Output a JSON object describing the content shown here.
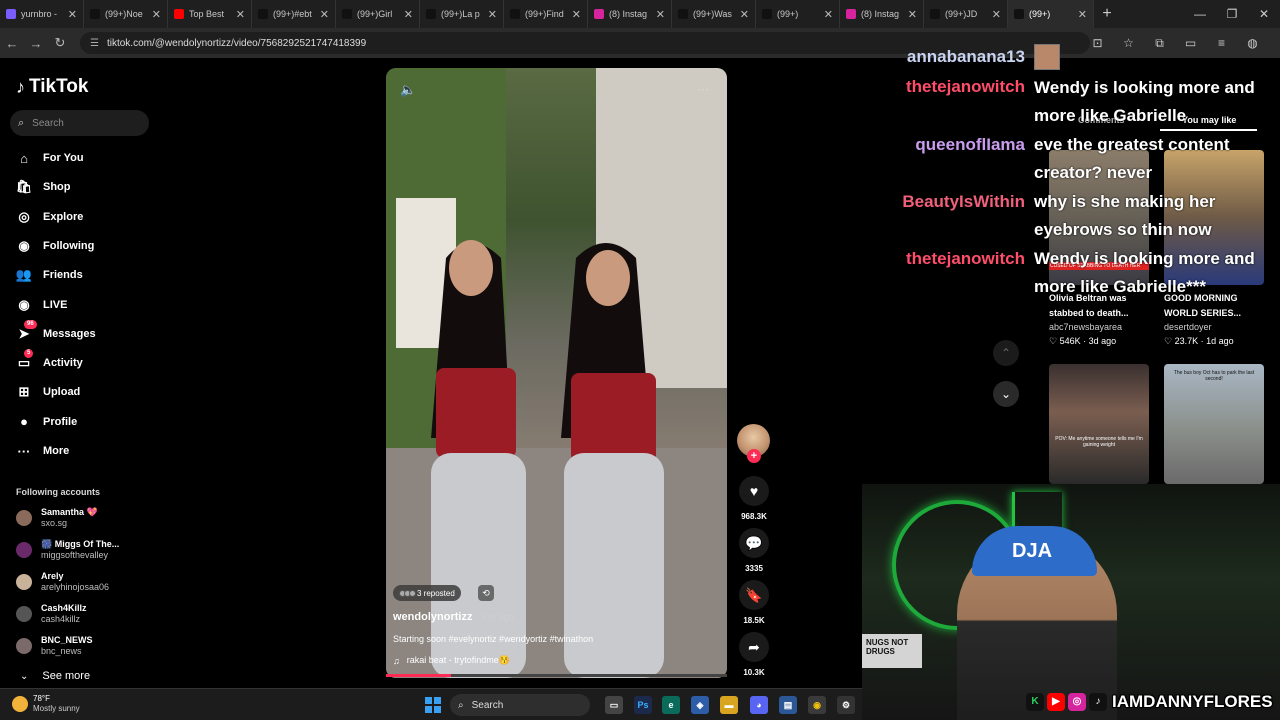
{
  "browser": {
    "tabs": [
      {
        "title": "yurnbro -",
        "color": "#7b5cff"
      },
      {
        "title": "(99+)Noe",
        "color": "#111111"
      },
      {
        "title": "Top Best",
        "color": "#ff0000"
      },
      {
        "title": "(99+)#ebt",
        "color": "#111111"
      },
      {
        "title": "(99+)Girl",
        "color": "#111111"
      },
      {
        "title": "(99+)La p",
        "color": "#111111"
      },
      {
        "title": "(99+)Find",
        "color": "#111111"
      },
      {
        "title": "(8) Instag",
        "color": "#d6249f"
      },
      {
        "title": "(99+)Was",
        "color": "#111111"
      },
      {
        "title": "(99+)",
        "color": "#111111"
      },
      {
        "title": "(8) Instag",
        "color": "#d6249f"
      },
      {
        "title": "(99+)JD",
        "color": "#111111"
      },
      {
        "title": "(99+)",
        "color": "#111111"
      }
    ],
    "new_tab": "+",
    "url": "tiktok.com/@wendolynortizz/video/7568292521747418399"
  },
  "sidebar": {
    "logo": "TikTok",
    "search_placeholder": "Search",
    "nav": [
      {
        "label": "For You",
        "icon": "home-icon",
        "glyph": "⌂",
        "badge": ""
      },
      {
        "label": "Shop",
        "icon": "shop-bag-icon",
        "glyph": "🛍",
        "badge": ""
      },
      {
        "label": "Explore",
        "icon": "compass-icon",
        "glyph": "◎",
        "badge": ""
      },
      {
        "label": "Following",
        "icon": "following-icon",
        "glyph": "◉",
        "badge": ""
      },
      {
        "label": "Friends",
        "icon": "friends-icon",
        "glyph": "👥",
        "badge": ""
      },
      {
        "label": "LIVE",
        "icon": "live-icon",
        "glyph": "◉",
        "badge": ""
      },
      {
        "label": "Messages",
        "icon": "messages-icon",
        "glyph": "➤",
        "badge": "96"
      },
      {
        "label": "Activity",
        "icon": "activity-icon",
        "glyph": "▭",
        "badge": "5"
      },
      {
        "label": "Upload",
        "icon": "upload-icon",
        "glyph": "⊞",
        "badge": ""
      },
      {
        "label": "Profile",
        "icon": "profile-icon",
        "glyph": "●",
        "badge": ""
      },
      {
        "label": "More",
        "icon": "more-icon",
        "glyph": "···",
        "badge": ""
      }
    ],
    "following_header": "Following accounts",
    "accounts": [
      {
        "name": "Samantha 💖",
        "handle": "sxo.sg",
        "color": "#8a6a5a"
      },
      {
        "name": "🎆 Miggs Of The...",
        "handle": "miggsofthevalley",
        "color": "#6a2a6a"
      },
      {
        "name": "Arely",
        "handle": "arelyhinojosaa06",
        "color": "#c9b29a"
      },
      {
        "name": "Cash4Killz",
        "handle": "cash4killz",
        "color": "#555555"
      },
      {
        "name": "BNC_NEWS",
        "handle": "bnc_news",
        "color": "#7a6a6a"
      }
    ],
    "see_more": "See more"
  },
  "video": {
    "repost_text": "3 reposted",
    "author": "wendolynortizz",
    "time_ago": "· 17h ago",
    "caption": "Starting soon #evelynortiz #wendyortiz #twinathon",
    "music": "rakai beat - trytofindme😚",
    "progress": 0.19,
    "likes": "968.3K",
    "comments": "3335",
    "saves": "18.5K",
    "shares": "10.3K"
  },
  "chat": {
    "names": [
      {
        "name": "annabanana13",
        "color": "#c8d4f0"
      },
      {
        "name": "thetejanowitch",
        "color": "#ff4d6a"
      },
      {
        "name": "queenoflIama",
        "color": "#c99cf0"
      },
      {
        "name": "BeautyIsWithin",
        "color": "#f0607a"
      },
      {
        "name": "thetejanowitch",
        "color": "#ff4d6a"
      }
    ],
    "messages": [
      "Wendy is looking more and more like Gabrielle",
      "eve the greatest content creator? never",
      "why is she making her eyebrows so thin now",
      "Wendy is looking more and more like Gabrielle***"
    ]
  },
  "right_panel": {
    "tabs": [
      "Comments",
      "You may like"
    ],
    "videos": [
      {
        "title": "Olivia Beltran was stabbed to death...",
        "author": "abc7newsbayarea",
        "stats": "♡ 546K · 3d ago"
      },
      {
        "title": "GOOD MORNING WORLD SERIES...",
        "author": "desertdoyer",
        "stats": "♡ 23.7K · 1d ago"
      },
      {
        "title": "POV: Me anytime someone tells me I'm gaining weight",
        "author": "",
        "stats": ""
      },
      {
        "title": "The bus boy Oct has to park the last second!",
        "author": "",
        "stats": ""
      }
    ],
    "thumb_overlay": "CUSED OF STABBING TO DEATH HER"
  },
  "webcam": {
    "cap_text": "DJA",
    "sign_text": "NUGS NOT DRUGS",
    "handle": "IAMDANNYFLORES"
  },
  "taskbar": {
    "temp": "78°F",
    "condition": "Mostly sunny",
    "search": "Search"
  }
}
